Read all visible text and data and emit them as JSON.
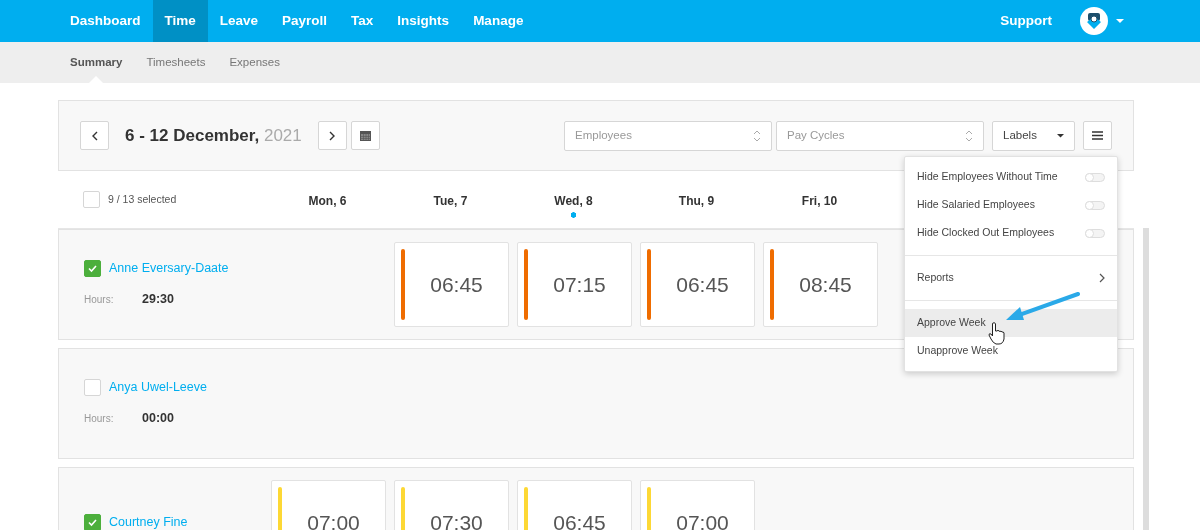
{
  "nav": {
    "items": [
      {
        "label": "Dashboard",
        "selected": false
      },
      {
        "label": "Time",
        "selected": true
      },
      {
        "label": "Leave",
        "selected": false
      },
      {
        "label": "Payroll",
        "selected": false
      },
      {
        "label": "Tax",
        "selected": false
      },
      {
        "label": "Insights",
        "selected": false
      },
      {
        "label": "Manage",
        "selected": false
      }
    ],
    "support": "Support"
  },
  "subnav": [
    {
      "label": "Summary",
      "selected": true
    },
    {
      "label": "Timesheets",
      "selected": false
    },
    {
      "label": "Expenses",
      "selected": false
    }
  ],
  "toolbar": {
    "date_range": "6 - 12 December,",
    "year": "2021",
    "filters": [
      {
        "placeholder": "Employees"
      },
      {
        "placeholder": "Pay Cycles"
      }
    ],
    "labels_button": "Labels"
  },
  "selection": {
    "checked": false,
    "text": "9 / 13 selected"
  },
  "days": [
    {
      "label": "Mon, 6",
      "today": false
    },
    {
      "label": "Tue, 7",
      "today": false
    },
    {
      "label": "Wed, 8",
      "today": true
    },
    {
      "label": "Thu, 9",
      "today": false
    },
    {
      "label": "Fri, 10",
      "today": false
    }
  ],
  "employees": [
    {
      "name": "Anne Eversary-Daate",
      "checked": true,
      "hours_label": "Hours:",
      "hours": "29:30",
      "entries": [
        {
          "kind": "empty"
        },
        {
          "kind": "time",
          "time": "06:45",
          "color": "#ef6c00"
        },
        {
          "kind": "time",
          "time": "07:15",
          "color": "#ef6c00"
        },
        {
          "kind": "time",
          "time": "06:45",
          "color": "#ef6c00"
        },
        {
          "kind": "time",
          "time": "08:45",
          "color": "#ef6c00"
        }
      ]
    },
    {
      "name": "Anya Uwel-Leeve",
      "checked": false,
      "hours_label": "Hours:",
      "hours": "00:00"
    },
    {
      "name": "Courtney Fine",
      "checked": true,
      "entries": [
        {
          "kind": "time",
          "time": "07:00",
          "color": "#fdd835"
        },
        {
          "kind": "time",
          "time": "07:30",
          "color": "#fdd835"
        },
        {
          "kind": "time",
          "time": "06:45",
          "color": "#fdd835"
        },
        {
          "kind": "time",
          "time": "07:00",
          "color": "#fdd835"
        }
      ]
    }
  ],
  "menu": {
    "toggles": [
      {
        "label": "Hide Employees Without Time",
        "on": false
      },
      {
        "label": "Hide Salaried Employees",
        "on": false
      },
      {
        "label": "Hide Clocked Out Employees",
        "on": false
      }
    ],
    "reports": "Reports",
    "actions": [
      {
        "label": "Approve Week",
        "selected": true
      },
      {
        "label": "Unapprove Week",
        "selected": false
      }
    ]
  }
}
